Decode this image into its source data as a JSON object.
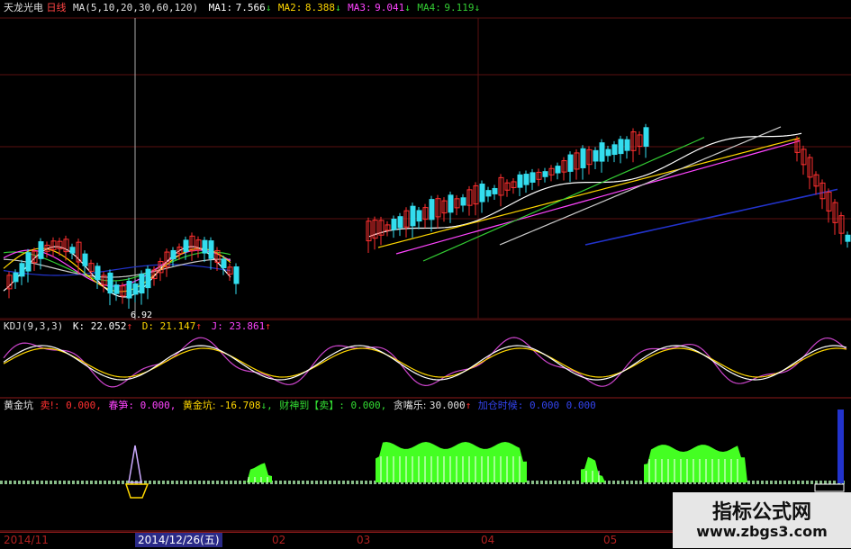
{
  "header": {
    "stock_name": "天龙光电",
    "period": "日线",
    "ma_params": "MA(5,10,20,30,60,120)",
    "ma1_label": "MA1:",
    "ma1_value": "7.566",
    "ma1_arrow": "↓",
    "ma2_label": "MA2:",
    "ma2_value": "8.388",
    "ma2_arrow": "↓",
    "ma3_label": "MA3:",
    "ma3_value": "9.041",
    "ma3_arrow": "↓",
    "ma4_label": "MA4:",
    "ma4_value": "9.119",
    "ma4_arrow": "↓"
  },
  "price_panel": {
    "low_label": "6.92"
  },
  "kdj": {
    "title": "KDJ(9,3,3)",
    "k_label": "K:",
    "k_value": "22.052",
    "k_arrow": "↑",
    "d_label": "D:",
    "d_value": "21.147",
    "d_arrow": "↑",
    "j_label": "J:",
    "j_value": "23.861",
    "j_arrow": "↑"
  },
  "indicator": {
    "title": "黄金坑",
    "sell_label": "卖!",
    "sell_value": ": 0.000,",
    "spring_label": "春笋",
    "spring_value": ": 0.000,",
    "pit_label": "黄金坑:",
    "pit_value": "-16.708",
    "pit_arrow": "↓,",
    "god_label": "财神到【卖】",
    "god_value": ": 0.000,",
    "joy_label": "贪嘴乐:",
    "joy_value": "30.000",
    "joy_arrow": "↑",
    "add_label": "加仓时候",
    "add_value": ": 0.000",
    "add_value2": "0.000"
  },
  "x_axis": {
    "ticks": [
      "2014/11",
      "2014/12/26(五)",
      "02",
      "03",
      "04",
      "05"
    ]
  },
  "watermark": {
    "title": "指标公式网",
    "url": "www.zbgs3.com"
  },
  "colors": {
    "background": "#000000",
    "panel_border": "#8b1a1a",
    "up_candle": "#ff3030",
    "down_candle": "#33ddee",
    "ma1": "#ffffff",
    "ma2": "#ffd700",
    "ma3": "#ff44ff",
    "ma4": "#33cc33",
    "ma5": "#cccccc",
    "ma6": "#2233cc",
    "kdj_k": "#ffffff",
    "kdj_d": "#ffd700",
    "kdj_j": "#cc44cc",
    "histogram": "#44ff22",
    "baseline": "#88bb88"
  }
}
